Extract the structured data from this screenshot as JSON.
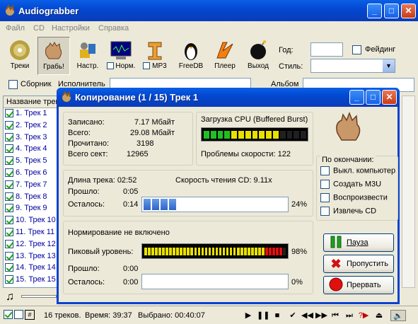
{
  "main_window": {
    "title": "Audiograbber",
    "menu": [
      "Файл",
      "CD",
      "Настройки",
      "Справка"
    ],
    "toolbar": [
      {
        "label": "Треки",
        "icon": "cd-icon"
      },
      {
        "label": "Грабь!",
        "icon": "grab-hand-icon"
      },
      {
        "label": "Настр.",
        "icon": "settings-icon"
      },
      {
        "label": "Норм.",
        "icon": "normalize-monitor-icon",
        "checked": false
      },
      {
        "label": "MP3",
        "icon": "mp3-clamp-icon",
        "checked": false
      },
      {
        "label": "FreeDB",
        "icon": "penguin-icon"
      },
      {
        "label": "Плеер",
        "icon": "player-winamp-icon"
      },
      {
        "label": "Выход",
        "icon": "exit-bomb-icon"
      }
    ],
    "year_label": "Год:",
    "year_value": "",
    "fade_label": "Фейдинг",
    "fade_checked": false,
    "style_label": "Стиль:",
    "style_value": "",
    "compilation_label": "Сборник",
    "artist_label": "Исполнитель",
    "album_label": "Альбом",
    "list_header": "Название трека",
    "tracks": [
      "1. Трек 1",
      "2. Трек 2",
      "3. Трек 3",
      "4. Трек 4",
      "5. Трек 5",
      "6. Трек 6",
      "7. Трек 7",
      "8. Трек 8",
      "9. Трек 9",
      "10. Трек 10",
      "11. Трек 11",
      "12. Трек 12",
      "13. Трек 13",
      "14. Трек 14",
      "15. Трек 15"
    ],
    "status": {
      "tracks": "16 треков.",
      "time": "Время: 39:37",
      "selected": "Выбрано: 00:40:07"
    }
  },
  "dialog": {
    "title": "Копирование  (1 / 15)   Трек  1",
    "stats": [
      {
        "label": "Записано:",
        "value": "7.17 Мбайт"
      },
      {
        "label": "Всего:",
        "value": "29.08 Мбайт"
      },
      {
        "label": "Прочитано:",
        "value": "3198"
      },
      {
        "label": "Всего сект:",
        "value": "12965"
      }
    ],
    "cpu_title": "Загрузка CPU (Buffered Burst)",
    "cpu_level": 0.75,
    "speed_problems": "Проблемы скорости: 122",
    "track_length": "Длина трека: 02:52",
    "read_speed": "Скорость чтения CD: 9.11x",
    "elapsed_label": "Прошло:",
    "elapsed_value": "0:05",
    "remaining_label": "Осталось:",
    "remaining_value": "0:14",
    "track_progress": 24,
    "track_progress_text": "24%",
    "norm_status": "Нормирование не включено",
    "peak_label": "Пиковый уровень:",
    "peak_level": 98,
    "peak_text": "98%",
    "norm_elapsed_label": "Прошло:",
    "norm_elapsed_value": "0:00",
    "norm_remaining_label": "Осталось:",
    "norm_remaining_value": "0:00",
    "norm_progress": 0,
    "norm_progress_text": "0%",
    "on_finish_label": "По окончании:",
    "on_finish": [
      {
        "label": "Выкл. компьютер",
        "checked": false
      },
      {
        "label": "Создать M3U",
        "checked": false
      },
      {
        "label": "Воспроизвести",
        "checked": false
      },
      {
        "label": "Извлечь CD",
        "checked": false
      }
    ],
    "buttons": {
      "pause": "Пауза",
      "skip": "Пропустить",
      "abort": "Прервать"
    }
  }
}
